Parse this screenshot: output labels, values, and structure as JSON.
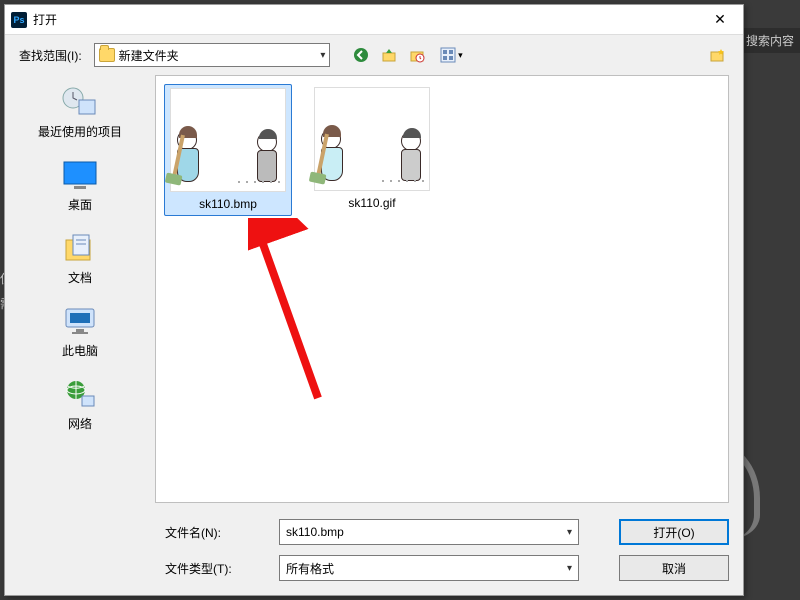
{
  "bg": {
    "right_hint": "搜索内容",
    "left_hint_1": "使",
    "left_hint_2": "需要"
  },
  "dialog": {
    "title": "打开",
    "close_glyph": "✕"
  },
  "toolbar": {
    "lookin_label": "查找范围(I):",
    "current_folder": "新建文件夹",
    "icon_back": "back-icon",
    "icon_up": "up-icon",
    "icon_recent": "recent-folder-icon",
    "icon_view": "view-menu-icon",
    "icon_newfolder": "new-folder-icon"
  },
  "places": [
    {
      "label": "最近使用的项目",
      "icon": "recent-items-icon"
    },
    {
      "label": "桌面",
      "icon": "desktop-icon"
    },
    {
      "label": "文档",
      "icon": "documents-icon"
    },
    {
      "label": "此电脑",
      "icon": "this-pc-icon"
    },
    {
      "label": "网络",
      "icon": "network-icon"
    }
  ],
  "files": [
    {
      "name": "sk110.bmp",
      "selected": true
    },
    {
      "name": "sk110.gif",
      "selected": false
    }
  ],
  "bottom": {
    "filename_label": "文件名(N):",
    "filename_value": "sk110.bmp",
    "filetype_label": "文件类型(T):",
    "filetype_value": "所有格式",
    "open_label": "打开(O)",
    "cancel_label": "取消"
  }
}
